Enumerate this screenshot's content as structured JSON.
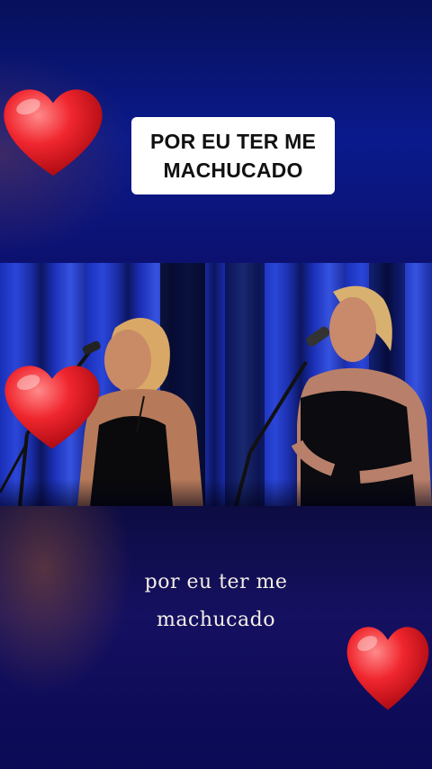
{
  "top_caption": {
    "line1": "POR EU TER ME",
    "line2": "MACHUCADO"
  },
  "lyrics": {
    "line1": "por eu ter me",
    "line2": "machucado"
  },
  "icons": [
    "heart-icon",
    "heart-icon",
    "heart-icon"
  ],
  "colors": {
    "heart": "#e8202a",
    "caption_bg": "#ffffff",
    "caption_text": "#111111",
    "lyrics_text": "#f4efe6"
  }
}
